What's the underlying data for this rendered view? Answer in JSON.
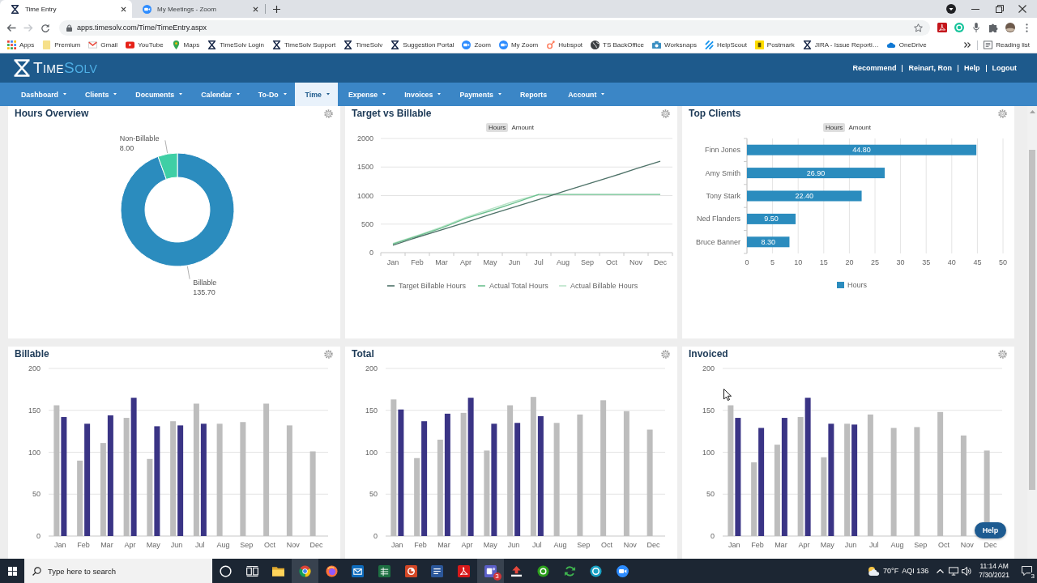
{
  "browser": {
    "tabs": [
      {
        "title": "Time Entry",
        "kind": "timesolv",
        "selected": true
      },
      {
        "title": "My Meetings - Zoom",
        "kind": "zoom",
        "selected": false
      }
    ],
    "forward_disabled": true,
    "url": "apps.timesolv.com/Time/TimeEntry.aspx",
    "bookmarks": [
      {
        "label": "Apps",
        "kind": "apps"
      },
      {
        "label": "Premium",
        "kind": "folder"
      },
      {
        "label": "Gmail",
        "kind": "gmail"
      },
      {
        "label": "YouTube",
        "kind": "youtube"
      },
      {
        "label": "Maps",
        "kind": "maps"
      },
      {
        "label": "TimeSolv Login",
        "kind": "timesolv"
      },
      {
        "label": "TimeSolv Support",
        "kind": "timesolv"
      },
      {
        "label": "TimeSolv",
        "kind": "timesolv"
      },
      {
        "label": "Suggestion Portal",
        "kind": "timesolv"
      },
      {
        "label": "Zoom",
        "kind": "zoom"
      },
      {
        "label": "My Zoom",
        "kind": "zoom"
      },
      {
        "label": "Hubspot",
        "kind": "hubspot"
      },
      {
        "label": "TS BackOffice",
        "kind": "globe"
      },
      {
        "label": "Worksnaps",
        "kind": "worksnaps"
      },
      {
        "label": "HelpScout",
        "kind": "helpscout"
      },
      {
        "label": "Postmark",
        "kind": "postmark"
      },
      {
        "label": "JIRA - Issue Reporti…",
        "kind": "timesolv"
      },
      {
        "label": "OneDrive",
        "kind": "onedrive"
      }
    ],
    "reading_list": "Reading list"
  },
  "app": {
    "logo": [
      "TIME",
      "SOLV"
    ],
    "user_links": [
      "Recommend",
      "Reinart, Ron",
      "Help",
      "Logout"
    ],
    "nav": [
      {
        "label": "Dashboard",
        "has_menu": true,
        "selected": false
      },
      {
        "label": "Clients",
        "has_menu": true,
        "selected": false
      },
      {
        "label": "Documents",
        "has_menu": true,
        "selected": false
      },
      {
        "label": "Calendar",
        "has_menu": true,
        "selected": false
      },
      {
        "label": "To-Do",
        "has_menu": true,
        "selected": false
      },
      {
        "label": "Time",
        "has_menu": true,
        "selected": true
      },
      {
        "label": "Expense",
        "has_menu": true,
        "selected": false
      },
      {
        "label": "Invoices",
        "has_menu": true,
        "selected": false
      },
      {
        "label": "Payments",
        "has_menu": true,
        "selected": false
      },
      {
        "label": "Reports",
        "has_menu": false,
        "selected": false
      },
      {
        "label": "Account",
        "has_menu": true,
        "selected": false
      }
    ]
  },
  "panels": [
    {
      "title": "Hours Overview",
      "chart_data": [
        {
          "type": "donut",
          "categories": [
            "Billable",
            "Non-Billable"
          ],
          "values": [
            135.7,
            8.0
          ],
          "colors": [
            "#2b8cbe",
            "#3fcfa5"
          ],
          "value_labels": [
            "135.70",
            "8.00"
          ]
        }
      ]
    },
    {
      "title": "Target vs Billable",
      "toggle": [
        {
          "label": "Hours",
          "selected": true
        },
        {
          "label": "Amount",
          "selected": false
        }
      ],
      "chart_data": [
        {
          "type": "line",
          "categories": [
            "Jan",
            "Feb",
            "Mar",
            "Apr",
            "May",
            "Jun",
            "Jul",
            "Aug",
            "Sep",
            "Oct",
            "Nov",
            "Dec"
          ],
          "ylim": [
            0,
            2000
          ],
          "yticks": [
            0,
            500,
            1000,
            1500,
            2000
          ],
          "grid": true,
          "legend": "bottom",
          "series": [
            {
              "name": "Target Billable Hours",
              "color": "#4e7268",
              "values": [
                130,
                270,
                400,
                530,
                670,
                800,
                930,
                1070,
                1200,
                1330,
                1470,
                1600
              ]
            },
            {
              "name": "Actual Total Hours",
              "color": "#6cc08f",
              "values": [
                150,
                290,
                430,
                600,
                730,
                870,
                1020,
                1020,
                1020,
                1020,
                1020,
                1020
              ]
            },
            {
              "name": "Actual Billable Hours",
              "color": "#b9e4c8",
              "values": [
                160,
                300,
                450,
                620,
                760,
                900,
                1020,
                null,
                null,
                null,
                null,
                null
              ]
            }
          ]
        }
      ]
    },
    {
      "title": "Top Clients",
      "toggle": [
        {
          "label": "Hours",
          "selected": true
        },
        {
          "label": "Amount",
          "selected": false
        }
      ],
      "chart_data": [
        {
          "type": "bar",
          "orientation": "horizontal",
          "categories": [
            "Finn Jones",
            "Amy Smith",
            "Tony Stark",
            "Ned Flanders",
            "Bruce Banner"
          ],
          "xlim": [
            0,
            50
          ],
          "xticks": [
            0,
            5,
            10,
            15,
            20,
            25,
            30,
            35,
            40,
            45,
            50
          ],
          "grid": true,
          "series": [
            {
              "name": "Hours",
              "color": "#2b8cbe",
              "values": [
                44.8,
                26.9,
                22.4,
                9.5,
                8.3
              ]
            }
          ],
          "value_labels": [
            "44.80",
            "26.90",
            "22.40",
            "9.50",
            "8.30"
          ],
          "legend": "bottom"
        }
      ]
    },
    {
      "title": "Billable",
      "chart_data": [
        {
          "type": "bar",
          "categories": [
            "Jan",
            "Feb",
            "Mar",
            "Apr",
            "May",
            "Jun",
            "Jul",
            "Aug",
            "Sep",
            "Oct",
            "Nov",
            "Dec"
          ],
          "ylim": [
            0,
            200
          ],
          "yticks": [
            0,
            50,
            100,
            150,
            200
          ],
          "grid": true,
          "series": [
            {
              "color": "#bdbdbd",
              "values": [
                156,
                90,
                111,
                141,
                92,
                137,
                158,
                134,
                136,
                158,
                132,
                101
              ]
            },
            {
              "color": "#3a3485",
              "values": [
                142,
                134,
                144,
                165,
                131,
                132,
                134,
                null,
                null,
                null,
                null,
                null
              ]
            }
          ]
        }
      ]
    },
    {
      "title": "Total",
      "chart_data": [
        {
          "type": "bar",
          "categories": [
            "Jan",
            "Feb",
            "Mar",
            "Apr",
            "May",
            "Jun",
            "Jul",
            "Aug",
            "Sep",
            "Oct",
            "Nov",
            "Dec"
          ],
          "ylim": [
            0,
            200
          ],
          "yticks": [
            0,
            50,
            100,
            150,
            200
          ],
          "grid": true,
          "series": [
            {
              "color": "#bdbdbd",
              "values": [
                163,
                93,
                115,
                147,
                102,
                156,
                166,
                135,
                145,
                162,
                149,
                127
              ]
            },
            {
              "color": "#3a3485",
              "values": [
                151,
                137,
                146,
                165,
                134,
                135,
                143,
                null,
                null,
                null,
                null,
                null
              ]
            }
          ]
        }
      ]
    },
    {
      "title": "Invoiced",
      "chart_data": [
        {
          "type": "bar",
          "categories": [
            "Jan",
            "Feb",
            "Mar",
            "Apr",
            "May",
            "Jun",
            "Jul",
            "Aug",
            "Sep",
            "Oct",
            "Nov",
            "Dec"
          ],
          "ylim": [
            0,
            200
          ],
          "yticks": [
            0,
            50,
            100,
            150,
            200
          ],
          "grid": true,
          "series": [
            {
              "color": "#bdbdbd",
              "values": [
                156,
                88,
                109,
                142,
                94,
                134,
                145,
                129,
                130,
                148,
                120,
                102
              ]
            },
            {
              "color": "#3a3485",
              "values": [
                141,
                129,
                141,
                165,
                134,
                133,
                null,
                null,
                null,
                null,
                null,
                null
              ]
            }
          ]
        }
      ]
    }
  ],
  "help_button": "Help",
  "taskbar": {
    "search": {
      "placeholder": "Type here to search"
    },
    "apps": [
      {
        "kind": "cortana",
        "active": false
      },
      {
        "kind": "task-view",
        "active": false
      },
      {
        "kind": "explorer",
        "active": false
      },
      {
        "kind": "chrome",
        "active": true
      },
      {
        "kind": "firefox",
        "active": false
      },
      {
        "kind": "outlook",
        "active": false
      },
      {
        "kind": "excel",
        "active": false
      },
      {
        "kind": "powerpoint",
        "active": false
      },
      {
        "kind": "word",
        "active": false
      },
      {
        "kind": "acrobat",
        "active": false
      },
      {
        "kind": "teams",
        "active": true,
        "badge": "3"
      },
      {
        "kind": "snip",
        "active": false
      },
      {
        "kind": "quickbooks",
        "active": false
      },
      {
        "kind": "sync",
        "active": false
      },
      {
        "kind": "vpn",
        "active": false
      },
      {
        "kind": "zoom",
        "active": false
      }
    ],
    "weather": "70°F",
    "aqi": "AQI 136",
    "time": "11:14 AM",
    "date": "7/30/2021",
    "notifications": "3"
  }
}
